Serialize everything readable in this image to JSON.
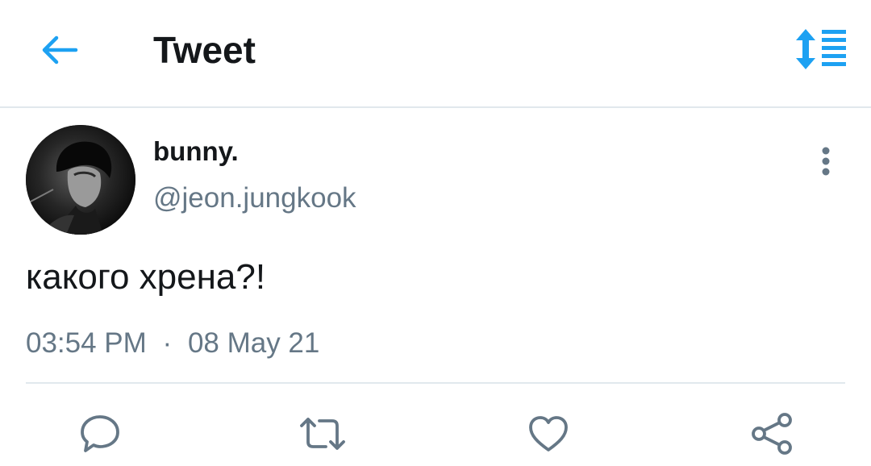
{
  "header": {
    "title": "Tweet",
    "back_icon": "arrow-left-icon",
    "sort_icon": "sort-list-icon",
    "accent_color": "#1da1f2"
  },
  "tweet": {
    "display_name": "bunny.",
    "handle": "@jeon.jungkook",
    "text": "какого хрена?!",
    "time": "03:54 PM",
    "separator": "·",
    "date": "08 May 21",
    "more_icon": "more-vertical-icon"
  },
  "actions": {
    "icons": [
      "reply-icon",
      "retweet-icon",
      "like-icon",
      "share-icon"
    ],
    "icon_color": "#657786"
  },
  "colors": {
    "text_primary": "#14171a",
    "text_secondary": "#657786",
    "divider": "#e1e8ed"
  }
}
